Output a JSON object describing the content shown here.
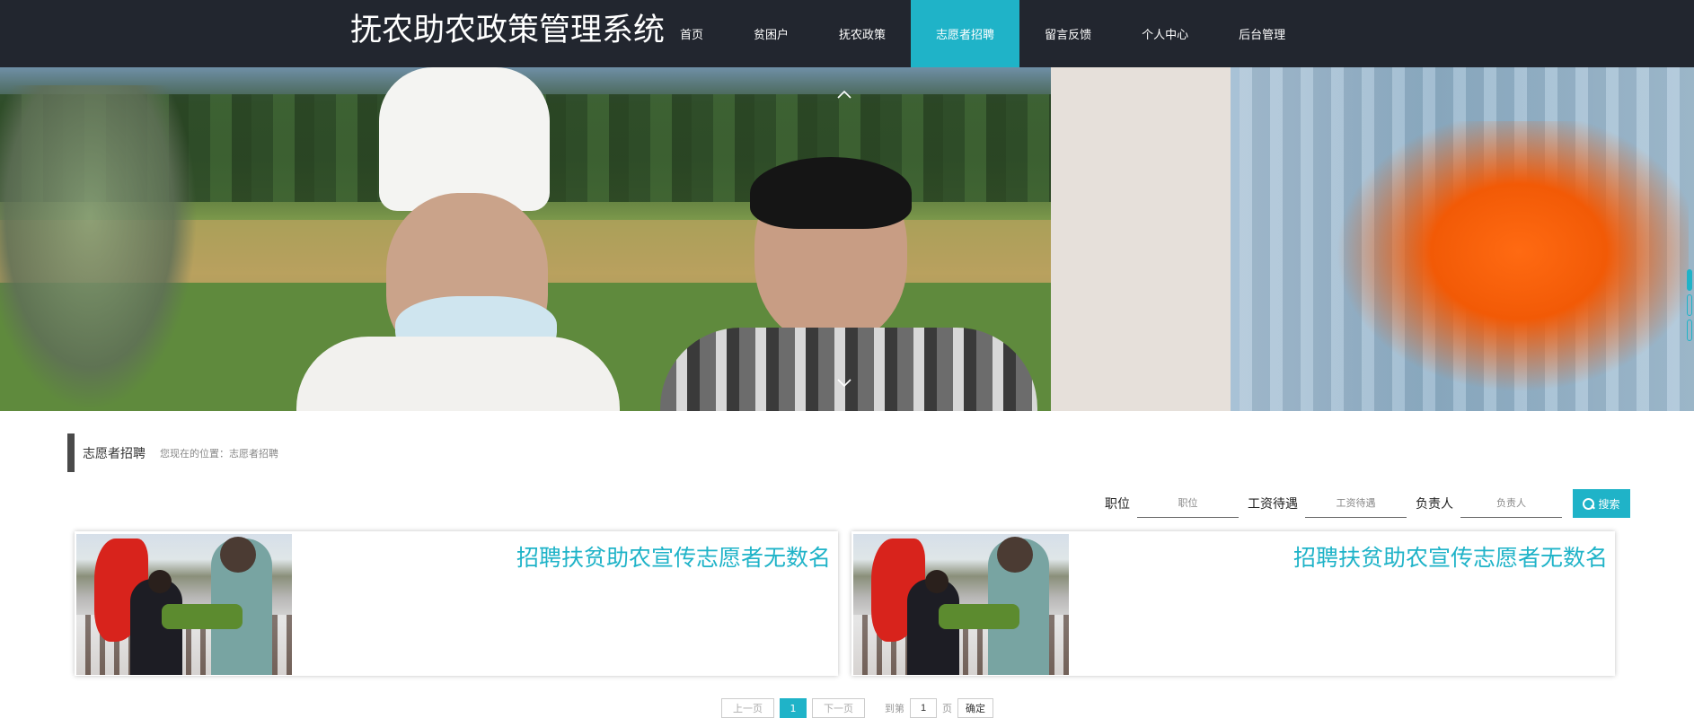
{
  "header": {
    "title": "抚农助农政策管理系统",
    "nav": [
      {
        "label": "首页",
        "active": false
      },
      {
        "label": "贫困户",
        "active": false
      },
      {
        "label": "抚农政策",
        "active": false
      },
      {
        "label": "志愿者招聘",
        "active": true
      },
      {
        "label": "留言反馈",
        "active": false
      },
      {
        "label": "个人中心",
        "active": false
      },
      {
        "label": "后台管理",
        "active": false
      }
    ]
  },
  "banner": {
    "prev_icon": "chevron-up-icon",
    "next_icon": "chevron-down-icon",
    "slide_count": 3,
    "active_slide": 1
  },
  "section": {
    "title": "志愿者招聘",
    "breadcrumb": "您现在的位置：志愿者招聘"
  },
  "search": {
    "fields": [
      {
        "label": "职位",
        "placeholder": "职位"
      },
      {
        "label": "工资待遇",
        "placeholder": "工资待遇"
      },
      {
        "label": "负责人",
        "placeholder": "负责人"
      }
    ],
    "button_label": "搜索",
    "button_icon": "search-icon"
  },
  "cards": [
    {
      "title": "招聘扶贫助农宣传志愿者无数名"
    },
    {
      "title": "招聘扶贫助农宣传志愿者无数名"
    }
  ],
  "pagination": {
    "prev_label": "上一页",
    "current_page": "1",
    "next_label": "下一页",
    "goto_prefix": "到第",
    "goto_value": "1",
    "goto_suffix": "页",
    "confirm_label": "确定"
  },
  "colors": {
    "accent": "#1fb3c8",
    "header_bg": "#22262f"
  }
}
